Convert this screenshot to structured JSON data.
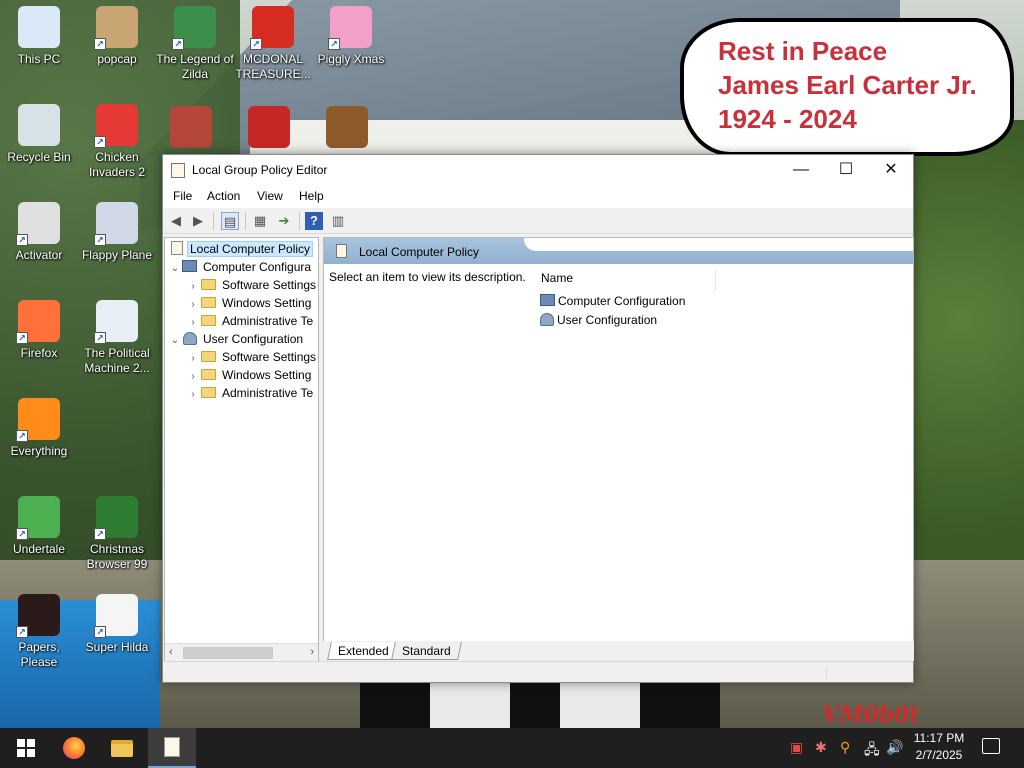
{
  "memorial": {
    "line1": "Rest in Peace",
    "line2": "James Earl Carter Jr.",
    "line3": "1924 - 2024"
  },
  "watermark": "VM0b0t",
  "desktop_icons": [
    {
      "label": "This PC",
      "icon": "computer-icon",
      "color": "#dbe8f7"
    },
    {
      "label": "popcap",
      "icon": "popcap-icon",
      "color": "#c9a574"
    },
    {
      "label": "The Legend of Zilda",
      "icon": "zilda-icon",
      "color": "#3b8f4a"
    },
    {
      "label": "MCDONAL TREASURE...",
      "icon": "mcdonalds-icon",
      "color": "#d62d20"
    },
    {
      "label": "Piggly Xmas",
      "icon": "pig-icon",
      "color": "#f2a0c8"
    },
    {
      "label": "Recycle Bin",
      "icon": "recycle-bin-icon",
      "color": "#d6e2e8"
    },
    {
      "label": "Chicken Invaders 2",
      "icon": "chicken-icon",
      "color": "#e53935"
    },
    {
      "label": "Activator",
      "icon": "activator-icon",
      "color": "#e0e0e0"
    },
    {
      "label": "Flappy Plane",
      "icon": "plane-icon",
      "color": "#d0d8e8"
    },
    {
      "label": "Firefox",
      "icon": "firefox-icon",
      "color": "#ff7139"
    },
    {
      "label": "The Political Machine 2...",
      "icon": "political-icon",
      "color": "#e8eef6"
    },
    {
      "label": "Everything",
      "icon": "search-icon",
      "color": "#ff8c1a"
    },
    {
      "label": "Undertale",
      "icon": "undertale-icon",
      "color": "#4caf50"
    },
    {
      "label": "Christmas Browser 99",
      "icon": "tree-icon",
      "color": "#2e7d32"
    },
    {
      "label": "Papers, Please",
      "icon": "papers-icon",
      "color": "#2a1a1a"
    },
    {
      "label": "Super Hilda",
      "icon": "hilda-icon",
      "color": "#f5f5f5"
    }
  ],
  "extra_desktop_icons": [
    {
      "label": "",
      "icon": "seasons-icon",
      "color": "#b5473a"
    },
    {
      "label": "",
      "icon": "snowman-icon",
      "color": "#c62828"
    },
    {
      "label": "",
      "icon": "teddy-bear-icon",
      "color": "#8d5a2b"
    }
  ],
  "window": {
    "title": "Local Group Policy Editor",
    "minimize": "—",
    "maximize": "☐",
    "close": "✕",
    "menu": [
      "File",
      "Action",
      "View",
      "Help"
    ],
    "tree": {
      "root": "Local Computer Policy",
      "computer": "Computer Configura",
      "computer_children": [
        "Software Settings",
        "Windows Setting",
        "Administrative Te"
      ],
      "user": "User Configuration",
      "user_children": [
        "Software Settings",
        "Windows Setting",
        "Administrative Te"
      ]
    },
    "detail": {
      "header": "Local Computer Policy",
      "description": "Select an item to view its description.",
      "name_column": "Name",
      "items": [
        "Computer Configuration",
        "User Configuration"
      ]
    },
    "tabs": [
      "Extended",
      "Standard"
    ]
  },
  "taskbar": {
    "time": "11:17 PM",
    "date": "2/7/2025"
  }
}
